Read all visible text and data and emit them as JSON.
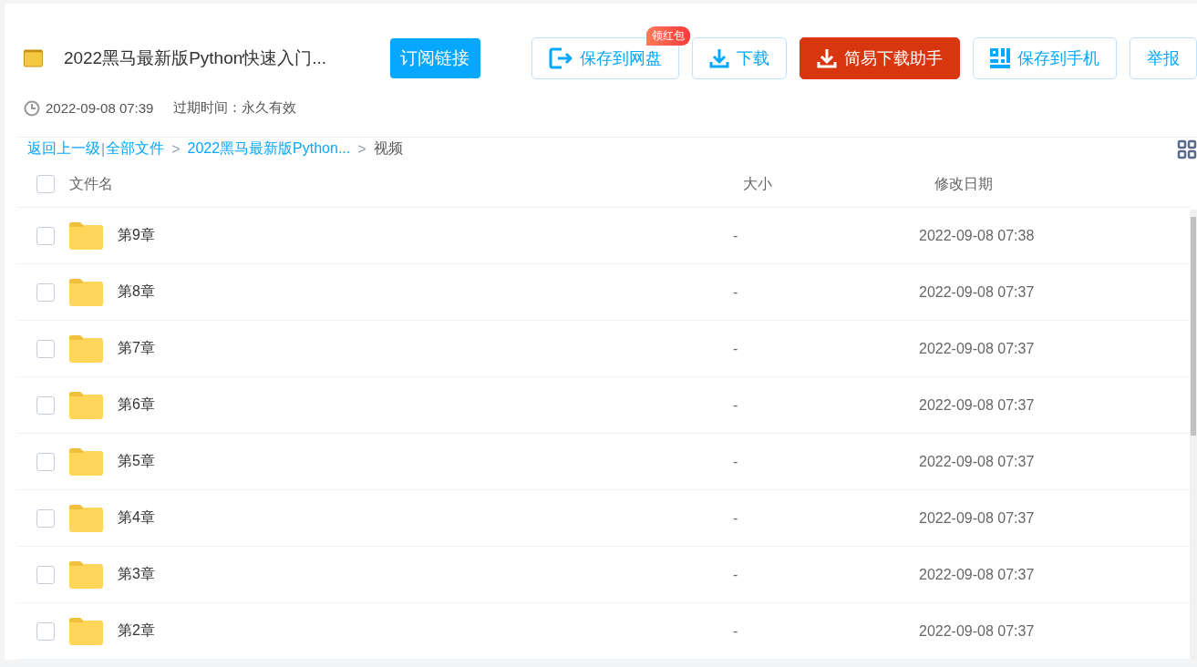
{
  "header": {
    "title": "2022黑马最新版Python快速入门...",
    "subscribe_button": "订阅链接",
    "actions": [
      {
        "kind": "save",
        "label": "保存到网盘",
        "badge": "领红包"
      },
      {
        "kind": "download",
        "label": "下载"
      },
      {
        "kind": "helper",
        "label": "简易下载助手"
      },
      {
        "kind": "phone",
        "label": "保存到手机"
      },
      {
        "kind": "report",
        "label": "举报"
      }
    ],
    "date": "2022-09-08 07:39",
    "expiry": "过期时间：永久有效"
  },
  "breadcrumb": {
    "back": "返回上一级",
    "separator": "|",
    "items": [
      {
        "label": "全部文件",
        "current": false
      },
      {
        "label": "2022黑马最新版Python...",
        "current": false
      },
      {
        "label": "视频",
        "current": true
      }
    ],
    "arrow": ">"
  },
  "table": {
    "columns": [
      "文件名",
      "大小",
      "修改日期"
    ],
    "all_checked": false,
    "rows": [
      {
        "name": "第9章",
        "size": "-",
        "date": "2022-09-08 07:38",
        "checked": false
      },
      {
        "name": "第8章",
        "size": "-",
        "date": "2022-09-08 07:37",
        "checked": false
      },
      {
        "name": "第7章",
        "size": "-",
        "date": "2022-09-08 07:37",
        "checked": false
      },
      {
        "name": "第6章",
        "size": "-",
        "date": "2022-09-08 07:37",
        "checked": false
      },
      {
        "name": "第5章",
        "size": "-",
        "date": "2022-09-08 07:37",
        "checked": false
      },
      {
        "name": "第4章",
        "size": "-",
        "date": "2022-09-08 07:37",
        "checked": false
      },
      {
        "name": "第3章",
        "size": "-",
        "date": "2022-09-08 07:37",
        "checked": false
      },
      {
        "name": "第2章",
        "size": "-",
        "date": "2022-09-08 07:37",
        "checked": false
      }
    ]
  }
}
